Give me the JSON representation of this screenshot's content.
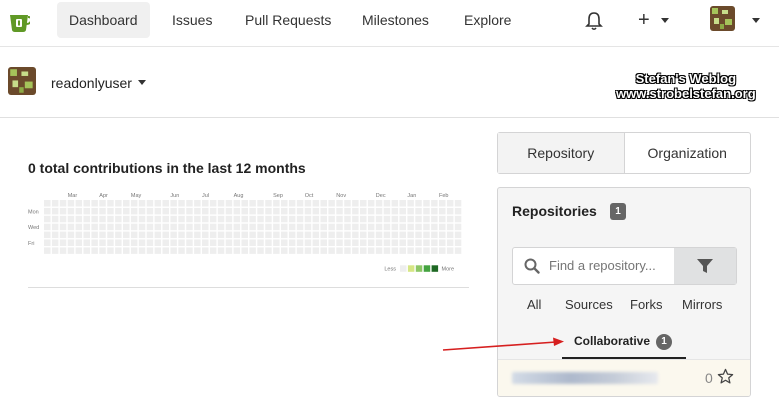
{
  "nav": {
    "items": [
      "Dashboard",
      "Issues",
      "Pull Requests",
      "Milestones",
      "Explore"
    ],
    "plus": "+"
  },
  "user": {
    "name": "readonlyuser"
  },
  "watermark": {
    "line1": "Stefan's Weblog",
    "line2": "www.strobelstefan.org"
  },
  "contributions": {
    "title": "0 total contributions in the last 12 months",
    "months": [
      "Mar",
      "Apr",
      "May",
      "Jun",
      "Jul",
      "Aug",
      "Sep",
      "Oct",
      "Nov",
      "Dec",
      "Jan",
      "Feb"
    ],
    "days": [
      "Mon",
      "Wed",
      "Fri"
    ],
    "legend_less": "Less",
    "legend_more": "More",
    "colors": [
      "#eeeeee",
      "#d6e685",
      "#8cc665",
      "#44a340",
      "#1e6823"
    ]
  },
  "tabs": [
    "Repository",
    "Organization"
  ],
  "repos": {
    "heading": "Repositories",
    "count": "1",
    "search_placeholder": "Find a repository...",
    "filters": [
      "All",
      "Sources",
      "Forks",
      "Mirrors"
    ],
    "collab_label": "Collaborative",
    "collab_count": "1",
    "row_stars": "0"
  }
}
